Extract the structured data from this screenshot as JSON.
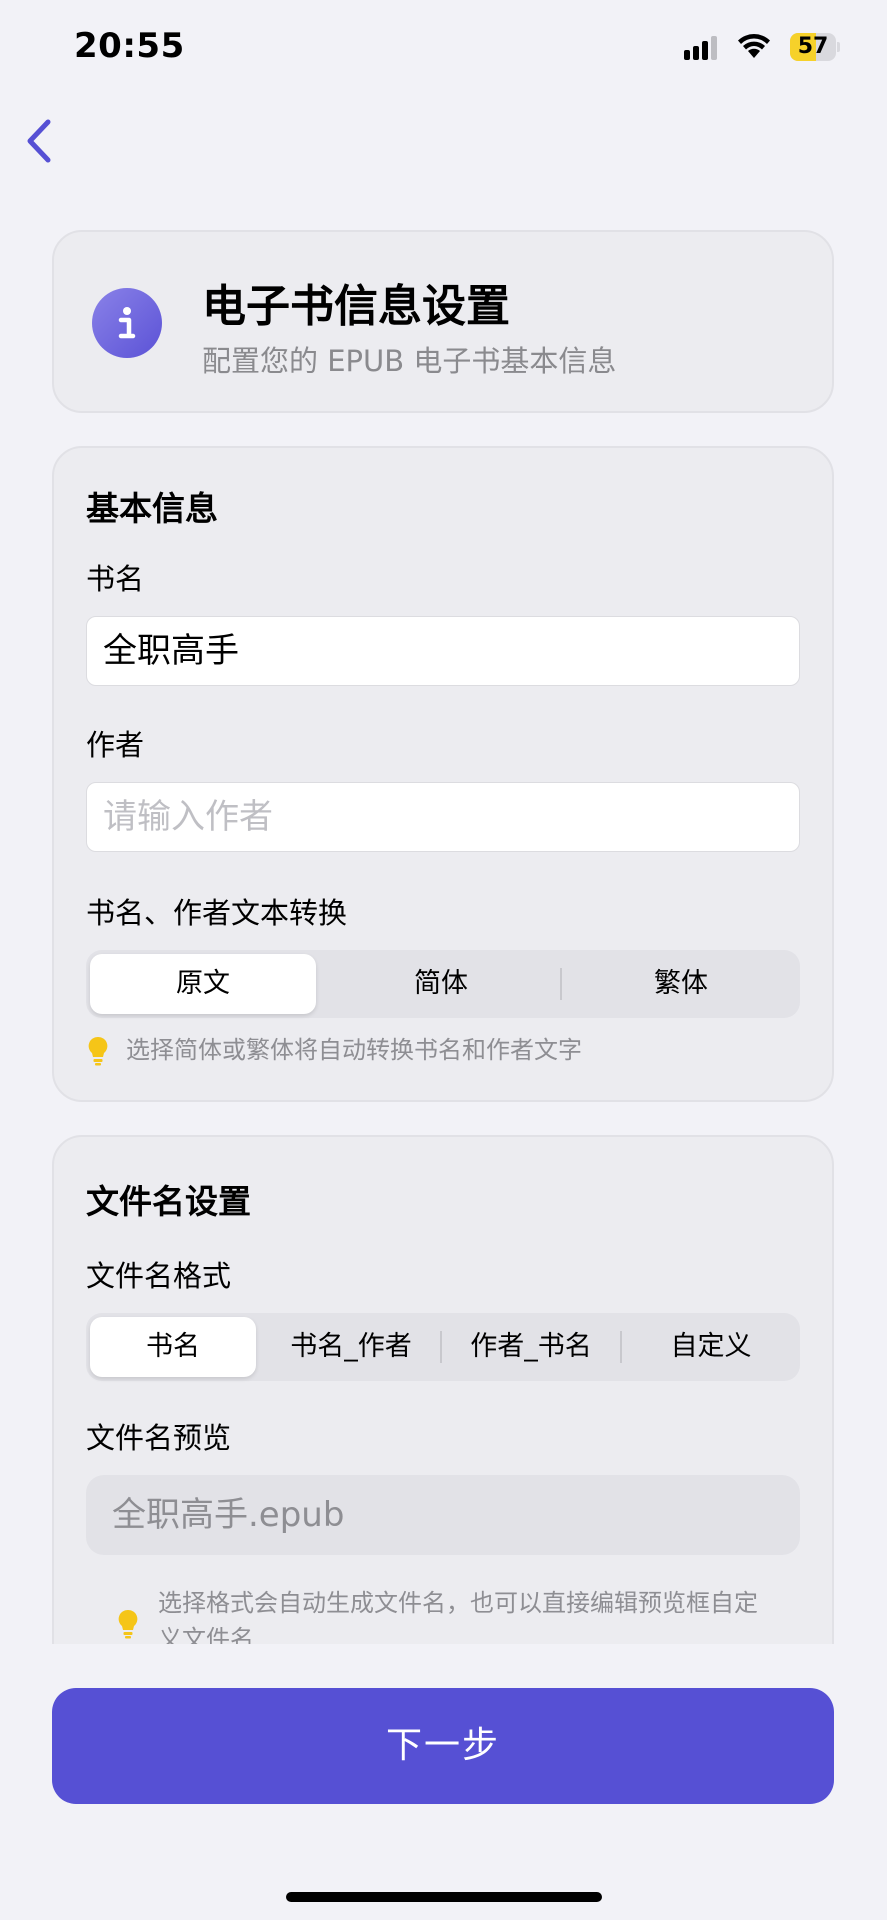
{
  "status_bar": {
    "time": "20:55",
    "battery": "57",
    "battery_level": 0.57
  },
  "header": {
    "title": "电子书信息设置",
    "subtitle": "配置您的 EPUB 电子书基本信息",
    "icon": "info-icon"
  },
  "basic_info": {
    "section_title": "基本信息",
    "title_label": "书名",
    "title_value": "全职高手",
    "author_label": "作者",
    "author_placeholder": "请输入作者",
    "conversion_label": "书名、作者文本转换",
    "conversion_options": [
      "原文",
      "简体",
      "繁体"
    ],
    "conversion_selected": "原文",
    "hint": "选择简体或繁体将自动转换书名和作者文字"
  },
  "filename": {
    "section_title": "文件名设置",
    "format_label": "文件名格式",
    "format_options": [
      "书名",
      "书名_作者",
      "作者_书名",
      "自定义"
    ],
    "format_selected": "书名",
    "preview_label": "文件名预览",
    "preview_value": "全职高手.epub",
    "hint": "选择格式会自动生成文件名，也可以直接编辑预览框自定义文件名"
  },
  "next_button": "下一步",
  "colors": {
    "accent": "#5650d4",
    "hint_bulb": "#f5c518",
    "background": "#f2f2f7"
  }
}
